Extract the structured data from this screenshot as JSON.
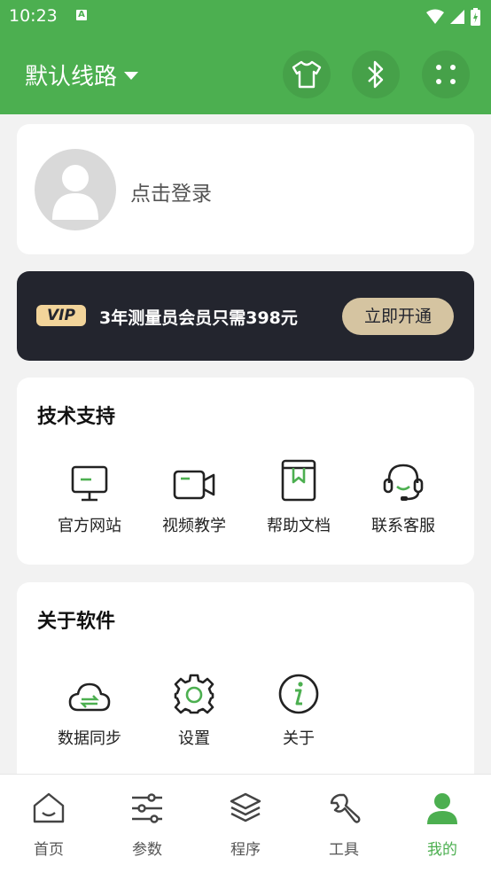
{
  "status_bar": {
    "time": "10:23",
    "notification_icon": "A"
  },
  "app_bar": {
    "route_label": "默认线路",
    "icons": [
      "shirt-icon",
      "bluetooth-icon",
      "scan-icon"
    ]
  },
  "login": {
    "prompt": "点击登录"
  },
  "vip": {
    "badge": "VIP",
    "text": "3年测量员会员只需398元",
    "button": "立即开通"
  },
  "tech_support": {
    "title": "技术支持",
    "items": [
      {
        "label": "官方网站",
        "icon": "monitor-icon"
      },
      {
        "label": "视频教学",
        "icon": "video-icon"
      },
      {
        "label": "帮助文档",
        "icon": "book-icon"
      },
      {
        "label": "联系客服",
        "icon": "headset-icon"
      }
    ]
  },
  "about_software": {
    "title": "关于软件",
    "items": [
      {
        "label": "数据同步",
        "icon": "cloud-sync-icon"
      },
      {
        "label": "设置",
        "icon": "gear-icon"
      },
      {
        "label": "关于",
        "icon": "info-icon"
      }
    ]
  },
  "tabs": [
    {
      "label": "首页",
      "icon": "home-icon",
      "active": false
    },
    {
      "label": "参数",
      "icon": "sliders-icon",
      "active": false
    },
    {
      "label": "程序",
      "icon": "layers-icon",
      "active": false
    },
    {
      "label": "工具",
      "icon": "wrench-icon",
      "active": false
    },
    {
      "label": "我的",
      "icon": "user-icon",
      "active": true
    }
  ],
  "colors": {
    "primary": "#4caf50",
    "vip_bg": "#23252e",
    "vip_gold": "#d5c4a1"
  }
}
